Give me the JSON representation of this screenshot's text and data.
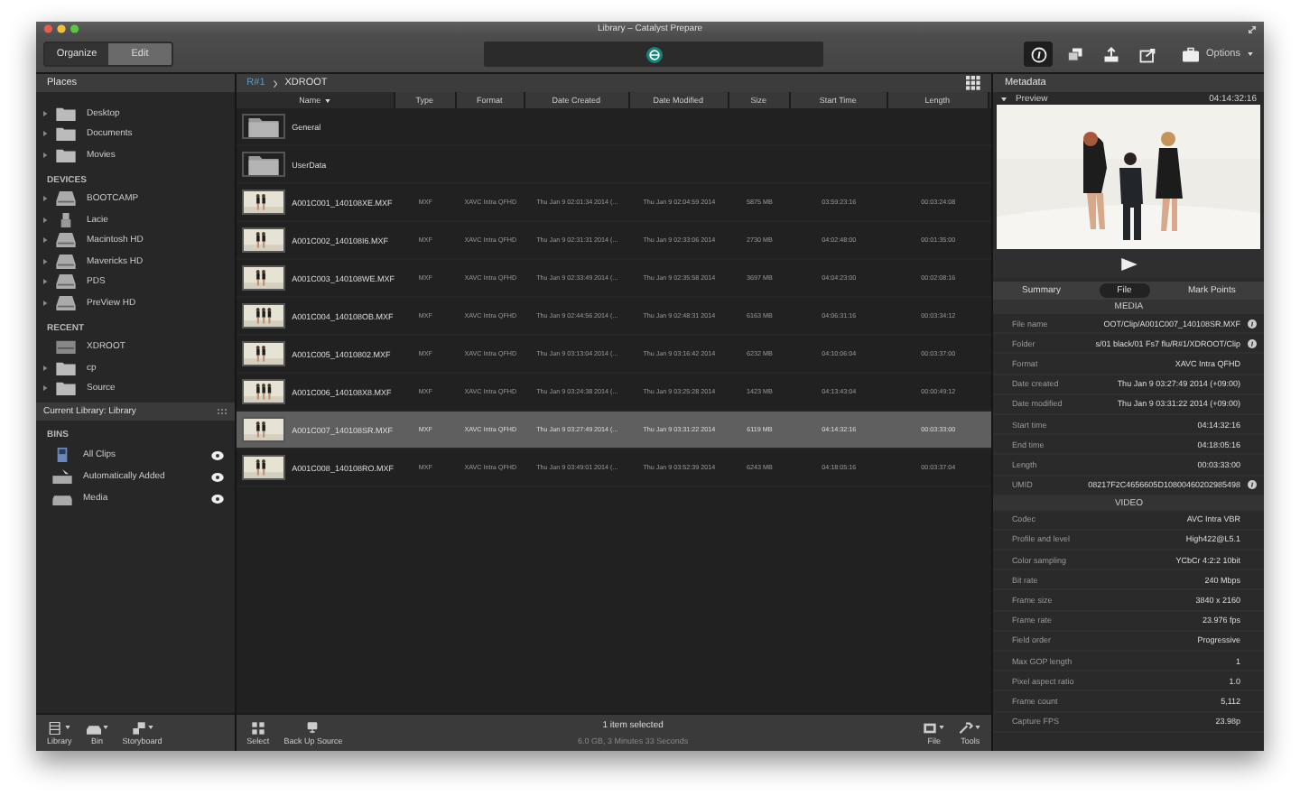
{
  "window": {
    "title": "Library – Catalyst Prepare"
  },
  "toolbar": {
    "modes": [
      {
        "label": "Organize",
        "selected": true
      },
      {
        "label": "Edit",
        "selected": false
      }
    ],
    "tools": [
      {
        "kind": "info",
        "selected": true
      },
      {
        "kind": "copy",
        "selected": false
      },
      {
        "kind": "export",
        "selected": false
      },
      {
        "kind": "share",
        "selected": false
      }
    ],
    "options": "Options"
  },
  "sidebar": {
    "header": "Places",
    "sections": [
      {
        "items": [
          {
            "label": "Desktop",
            "kind": "folder",
            "expandable": true
          },
          {
            "label": "Documents",
            "kind": "folder",
            "expandable": true
          },
          {
            "label": "Movies",
            "kind": "folder",
            "expandable": true
          }
        ]
      },
      {
        "heading": "DEVICES",
        "items": [
          {
            "label": "BOOTCAMP",
            "kind": "drive",
            "expandable": true
          },
          {
            "label": "Lacie",
            "kind": "usb",
            "expandable": true
          },
          {
            "label": "Macintosh HD",
            "kind": "drive",
            "expandable": true
          },
          {
            "label": "Mavericks HD",
            "kind": "drive",
            "expandable": true
          },
          {
            "label": "PDS",
            "kind": "drive",
            "expandable": true
          },
          {
            "label": "PreView HD",
            "kind": "drive",
            "expandable": true
          }
        ]
      },
      {
        "heading": "RECENT",
        "items": [
          {
            "label": "XDROOT",
            "kind": "card",
            "expandable": false
          },
          {
            "label": "cp",
            "kind": "folder",
            "expandable": true
          },
          {
            "label": "Source",
            "kind": "folder",
            "expandable": true
          }
        ]
      }
    ],
    "library_bar": "Current Library: Library",
    "bins": {
      "heading": "BINS",
      "items": [
        {
          "label": "All Clips",
          "kind": "clips"
        },
        {
          "label": "Automatically Added",
          "kind": "auto"
        },
        {
          "label": "Media",
          "kind": "media"
        }
      ]
    },
    "bottom_buttons": [
      {
        "label": "Library",
        "kind": "library"
      },
      {
        "label": "Bin",
        "kind": "bin"
      },
      {
        "label": "Storyboard",
        "kind": "storyboard"
      }
    ]
  },
  "browser": {
    "breadcrumb": [
      {
        "label": "R#1",
        "kind": "link"
      },
      {
        "label": "XDROOT",
        "kind": "current"
      }
    ],
    "columns": [
      {
        "label": "Name",
        "sorted": true
      },
      {
        "label": "Type",
        "sorted": false
      },
      {
        "label": "Format",
        "sorted": false
      },
      {
        "label": "Date Created",
        "sorted": false
      },
      {
        "label": "Date Modified",
        "sorted": false
      },
      {
        "label": "Size",
        "sorted": false
      },
      {
        "label": "Start Time",
        "sorted": false
      },
      {
        "label": "Length",
        "sorted": false
      }
    ],
    "rows": [
      {
        "kind": "folder",
        "name": "General",
        "selected": false
      },
      {
        "kind": "folder",
        "name": "UserData",
        "selected": false
      },
      {
        "kind": "clip",
        "name": "A001C001_140108XE.MXF",
        "type": "MXF",
        "format": "XAVC Intra QFHD",
        "created": "Thu Jan 9 02:01:34 2014 (...",
        "modified": "Thu Jan 9 02:04:59 2014",
        "size": "5875 MB",
        "start": "03:59:23:16",
        "length": "00:03:24:08",
        "selected": false
      },
      {
        "kind": "clip",
        "name": "A001C002_140108I6.MXF",
        "type": "MXF",
        "format": "XAVC Intra QFHD",
        "created": "Thu Jan 9 02:31:31 2014 (...",
        "modified": "Thu Jan 9 02:33:06 2014",
        "size": "2730 MB",
        "start": "04:02:48:00",
        "length": "00:01:35:00",
        "selected": false
      },
      {
        "kind": "clip",
        "name": "A001C003_140108WE.MXF",
        "type": "MXF",
        "format": "XAVC Intra QFHD",
        "created": "Thu Jan 9 02:33:49 2014 (...",
        "modified": "Thu Jan 9 02:35:58 2014",
        "size": "3697 MB",
        "start": "04:04:23:00",
        "length": "00:02:08:16",
        "selected": false
      },
      {
        "kind": "clip",
        "name": "A001C004_140108OB.MXF",
        "type": "MXF",
        "format": "XAVC Intra QFHD",
        "created": "Thu Jan 9 02:44:56 2014 (...",
        "modified": "Thu Jan 9 02:48:31 2014",
        "size": "6163 MB",
        "start": "04:06:31:16",
        "length": "00:03:34:12",
        "selected": false
      },
      {
        "kind": "clip",
        "name": "A001C005_14010802.MXF",
        "type": "MXF",
        "format": "XAVC Intra QFHD",
        "created": "Thu Jan 9 03:13:04 2014 (...",
        "modified": "Thu Jan 9 03:16:42 2014",
        "size": "6232 MB",
        "start": "04:10:06:04",
        "length": "00:03:37:00",
        "selected": false
      },
      {
        "kind": "clip",
        "name": "A001C006_140108X8.MXF",
        "type": "MXF",
        "format": "XAVC Intra QFHD",
        "created": "Thu Jan 9 03:24:38 2014 (...",
        "modified": "Thu Jan 9 03:25:28 2014",
        "size": "1423 MB",
        "start": "04:13:43:04",
        "length": "00:00:49:12",
        "selected": false
      },
      {
        "kind": "clip",
        "name": "A001C007_140108SR.MXF",
        "type": "MXF",
        "format": "XAVC Intra QFHD",
        "created": "Thu Jan 9 03:27:49 2014 (...",
        "modified": "Thu Jan 9 03:31:22 2014",
        "size": "6119 MB",
        "start": "04:14:32:16",
        "length": "00:03:33:00",
        "selected": true
      },
      {
        "kind": "clip",
        "name": "A001C008_140108RO.MXF",
        "type": "MXF",
        "format": "XAVC Intra QFHD",
        "created": "Thu Jan 9 03:49:01 2014 (...",
        "modified": "Thu Jan 9 03:52:39 2014",
        "size": "6243 MB",
        "start": "04:18:05:16",
        "length": "00:03:37:04",
        "selected": false
      }
    ],
    "left_buttons": [
      {
        "label": "Select",
        "kind": "select"
      },
      {
        "label": "Back Up Source",
        "kind": "backup"
      }
    ],
    "status": "1 item selected",
    "summary": "6.0 GB, 3 Minutes 33 Seconds",
    "right_buttons": [
      {
        "label": "File",
        "kind": "file"
      },
      {
        "label": "Tools",
        "kind": "tools"
      }
    ]
  },
  "metadata": {
    "header": "Metadata",
    "preview": {
      "label": "Preview",
      "timecode": "04:14:32:16"
    },
    "tabs": [
      {
        "label": "Summary",
        "selected": false
      },
      {
        "label": "File",
        "selected": true
      },
      {
        "label": "Mark Points",
        "selected": false
      }
    ],
    "sections": [
      {
        "heading": "MEDIA",
        "rows": [
          {
            "label": "File name",
            "value": "OOT/Clip/A001C007_140108SR.MXF",
            "info": true
          },
          {
            "label": "Folder",
            "value": "s/01 black/01 Fs7 flu/R#1/XDROOT/Clip",
            "info": true
          },
          {
            "label": "Format",
            "value": "XAVC Intra QFHD",
            "info": false
          },
          {
            "label": "Date created",
            "value": "Thu Jan 9 03:27:49 2014 (+09:00)",
            "info": false
          },
          {
            "label": "Date modified",
            "value": "Thu Jan 9 03:31:22 2014 (+09:00)",
            "info": false
          },
          {
            "label": "Start time",
            "value": "04:14:32:16",
            "info": false
          },
          {
            "label": "End time",
            "value": "04:18:05:16",
            "info": false
          },
          {
            "label": "Length",
            "value": "00:03:33:00",
            "info": false
          },
          {
            "label": "UMID",
            "value": "08217F2C4656605D10800460202985498",
            "info": true
          }
        ]
      },
      {
        "heading": "VIDEO",
        "rows": [
          {
            "label": "Codec",
            "value": "AVC Intra VBR",
            "info": false
          },
          {
            "label": "Profile and level",
            "value": "High422@L5.1",
            "info": false
          },
          {
            "label": "Color sampling",
            "value": "YCbCr 4:2:2 10bit",
            "info": false
          },
          {
            "label": "Bit rate",
            "value": "240 Mbps",
            "info": false
          },
          {
            "label": "Frame size",
            "value": "3840 x 2160",
            "info": false
          },
          {
            "label": "Frame rate",
            "value": "23.976 fps",
            "info": false
          },
          {
            "label": "Field order",
            "value": "Progressive",
            "info": false
          },
          {
            "label": "Max GOP length",
            "value": "1",
            "info": false
          },
          {
            "label": "Pixel aspect ratio",
            "value": "1.0",
            "info": false
          },
          {
            "label": "Frame count",
            "value": "5,112",
            "info": false
          },
          {
            "label": "Capture FPS",
            "value": "23.98p",
            "info": false
          }
        ]
      }
    ]
  }
}
